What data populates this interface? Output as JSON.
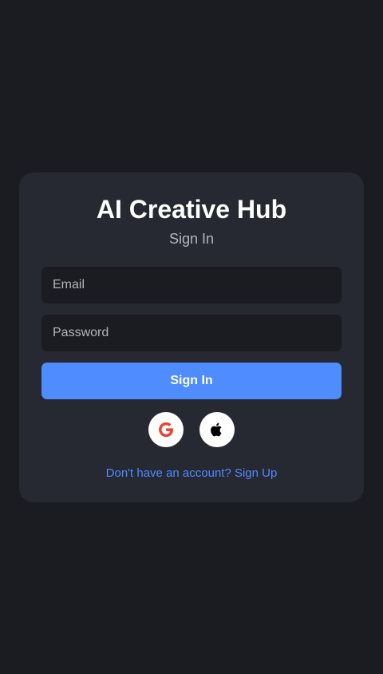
{
  "card": {
    "title": "AI Creative Hub",
    "subtitle": "Sign In"
  },
  "form": {
    "email_placeholder": "Email",
    "password_placeholder": "Password",
    "submit_label": "Sign In"
  },
  "social": [
    {
      "provider": "Google",
      "icon": "google-icon"
    },
    {
      "provider": "Apple",
      "icon": "apple-icon"
    }
  ],
  "footer": {
    "signup_link": "Don't have an account? Sign Up"
  },
  "colors": {
    "background": "#1b1c21",
    "card": "#262832",
    "accent": "#4f8cff",
    "input_bg": "#1b1c22",
    "google_red": "#ea4335"
  }
}
